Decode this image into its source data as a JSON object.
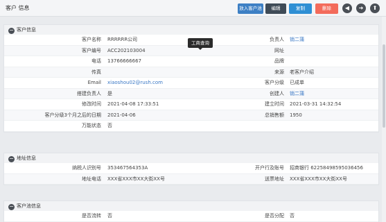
{
  "header": {
    "title": "客户 信息",
    "buttons": {
      "to_customer_pool": "放入客户池",
      "edit": "编辑",
      "copy": "复制",
      "delete": "删除"
    },
    "nav": {
      "prev": "◀",
      "next": "➜",
      "top": "⬆"
    }
  },
  "tooltip": "工商查询",
  "customer_section": {
    "title": "客户信息",
    "rows": [
      {
        "l1": "客户名称",
        "v1": "RRRRRR公司",
        "l2": "负责人",
        "v2": "销二蒲",
        "v2_link": true
      },
      {
        "l1": "客户编号",
        "v1": "ACC202103004",
        "l2": "网址",
        "v2": ""
      },
      {
        "l1": "电话",
        "v1": "13766666667",
        "l2": "品牌",
        "v2": ""
      },
      {
        "l1": "传真",
        "v1": "",
        "l2": "来源",
        "v2": "老客户介绍"
      },
      {
        "l1": "Email",
        "v1": "xiaoshou02@rush.com",
        "v1_link": true,
        "l2": "客户分级",
        "v2": "已成单"
      },
      {
        "l1": "搭建负责人",
        "v1": "是",
        "l2": "创建人",
        "v2": "销二蒲",
        "v2_link": true
      },
      {
        "l1": "修改时间",
        "v1": "2021-04-08 17:33:51",
        "l2": "建立时间",
        "v2": "2021-03-31 14:32:54"
      },
      {
        "l1": "客户分级3个月之后的日期",
        "v1": "2021-04-06",
        "l2": "总销售额",
        "v2": "1950"
      },
      {
        "l1": "万能状态",
        "v1": "否",
        "l2": "",
        "v2": ""
      }
    ]
  },
  "address_section": {
    "title": "地址信息",
    "rows": [
      {
        "l1": "纳税人识别号",
        "v1": "353467564353A",
        "l2": "开户行及账号",
        "v2": "招商银行 62258498595036456"
      },
      {
        "l1": "地址电话",
        "v1": "XXX省XXX市XX大街XX号",
        "l2": "送票地址",
        "v2": "XXX省XXX市XX大街XX号"
      }
    ]
  },
  "pool_section": {
    "title": "客户池信息",
    "rows": [
      {
        "l1": "是否流转",
        "v1": "否",
        "l2": "是否分配",
        "v2": "否"
      }
    ]
  }
}
